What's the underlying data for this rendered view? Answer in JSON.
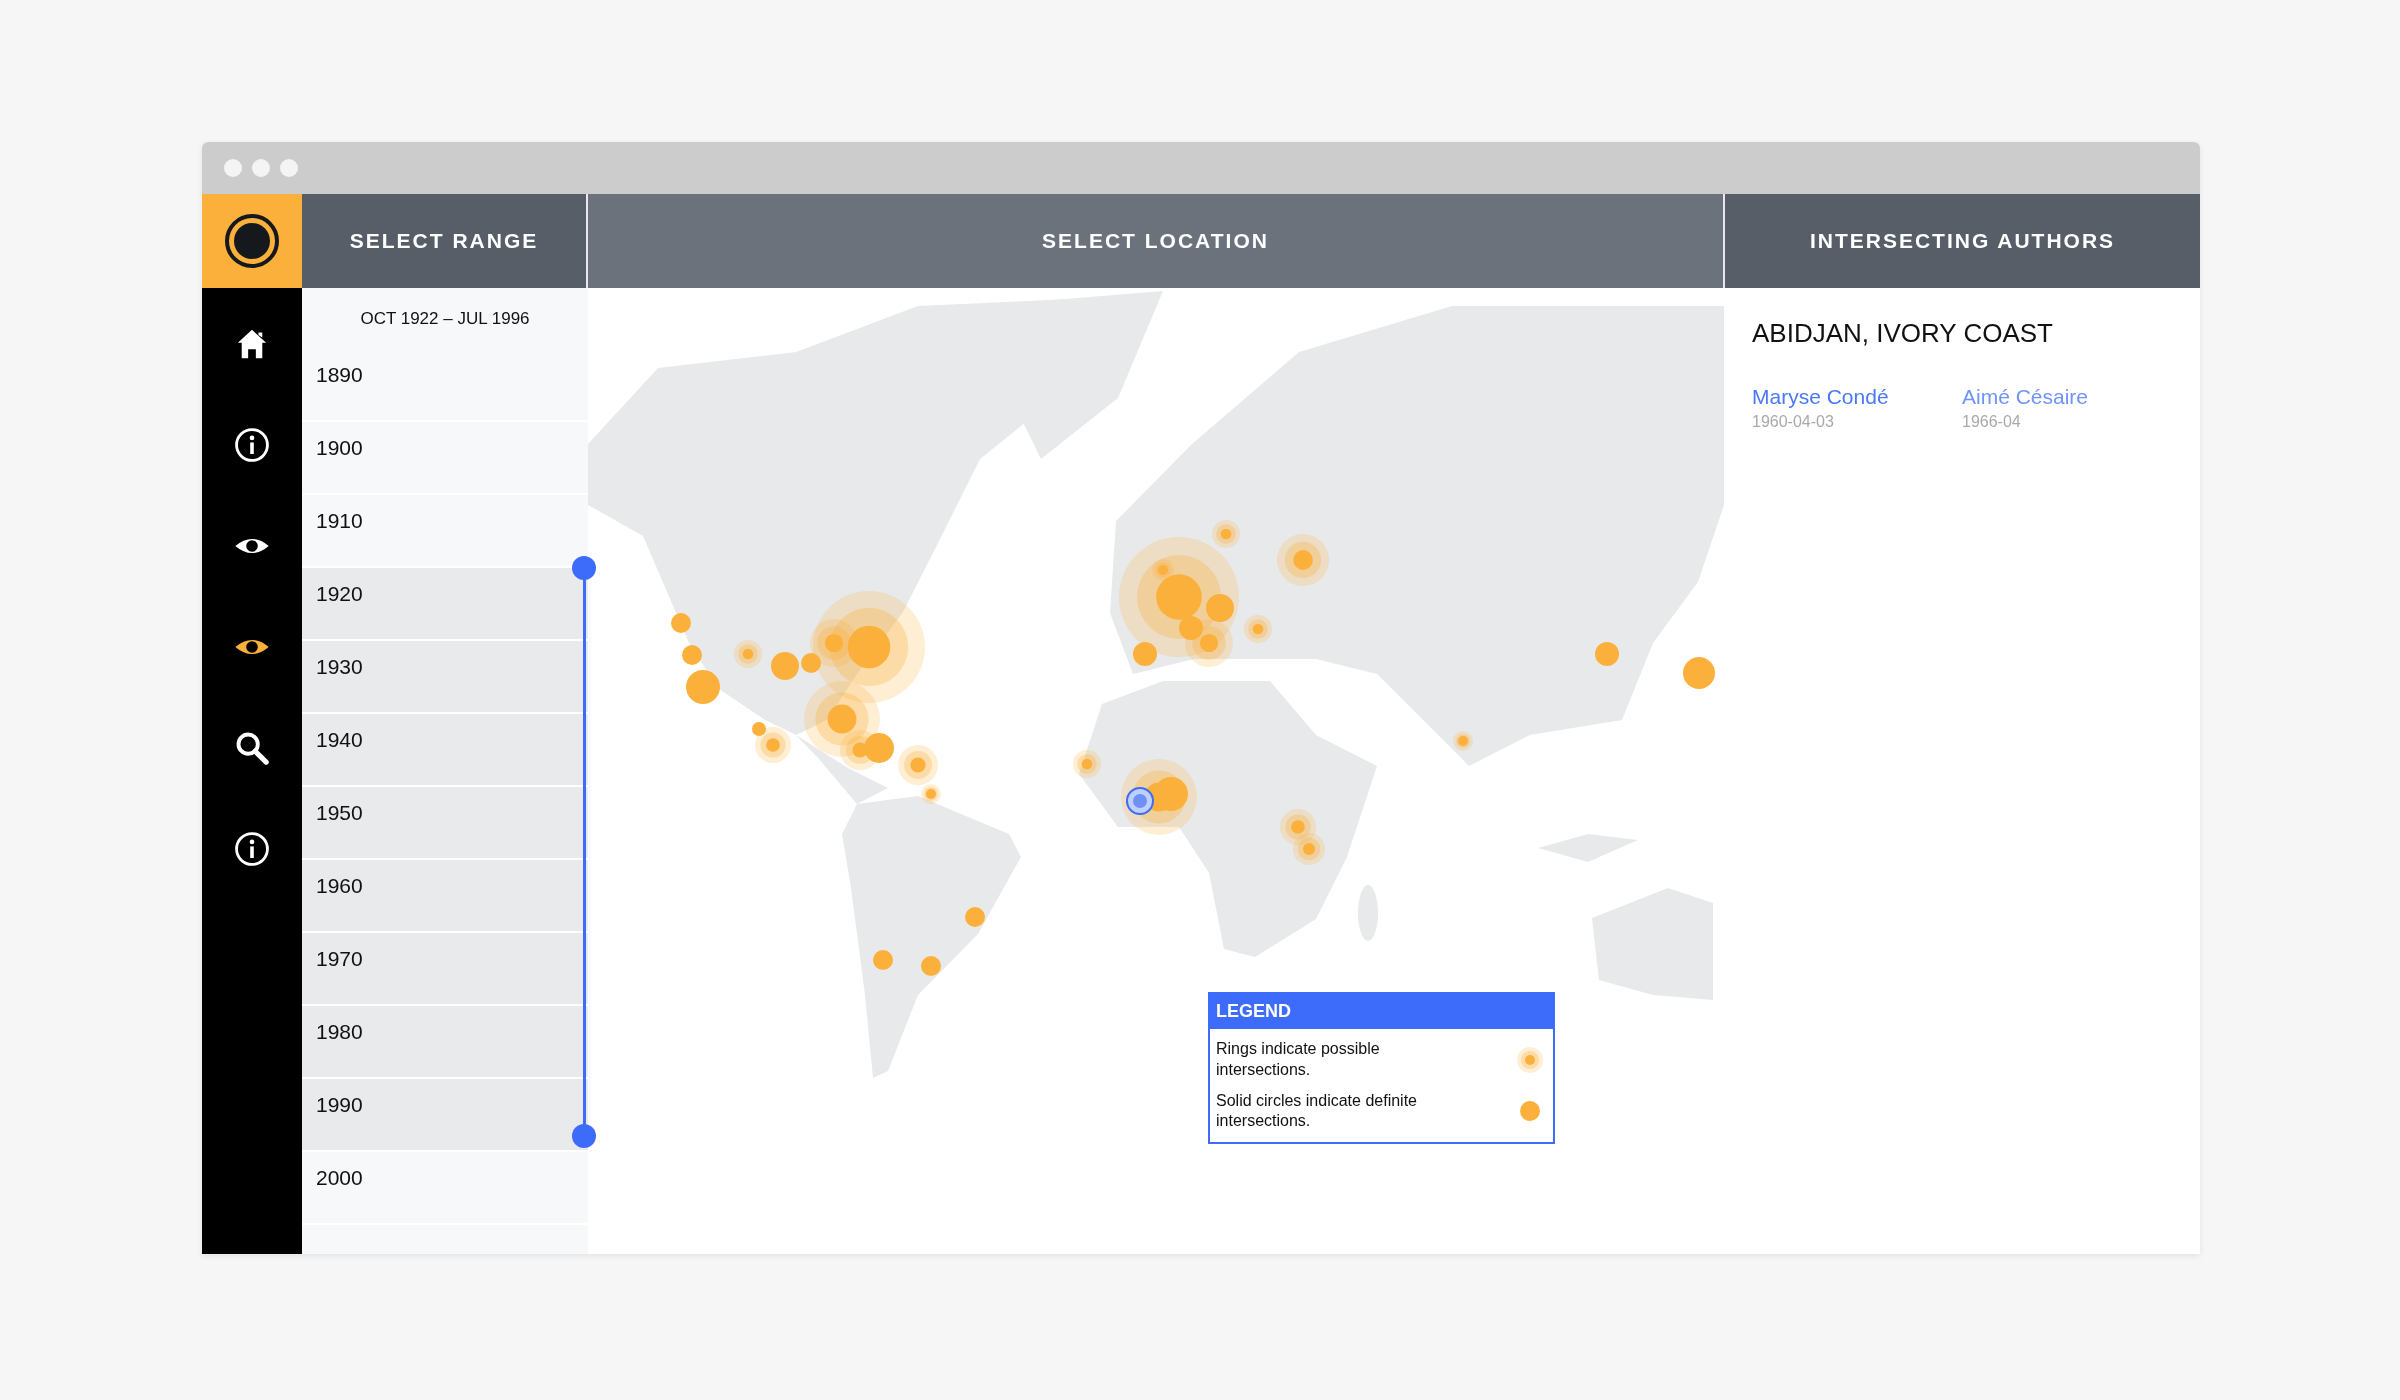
{
  "sidebar": {
    "items": [
      {
        "kind": "home",
        "selected": false
      },
      {
        "kind": "info",
        "selected": false
      },
      {
        "kind": "eye",
        "selected": false
      },
      {
        "kind": "eye",
        "selected": true
      },
      {
        "kind": "search",
        "selected": false
      },
      {
        "kind": "info",
        "selected": false
      }
    ]
  },
  "range": {
    "heading": "SELECT RANGE",
    "summary": "OCT 1922 – JUL 1996",
    "years": [
      {
        "label": "1890",
        "selected": false
      },
      {
        "label": "1900",
        "selected": false
      },
      {
        "label": "1910",
        "selected": false
      },
      {
        "label": "1920",
        "selected": true
      },
      {
        "label": "1930",
        "selected": true
      },
      {
        "label": "1940",
        "selected": true
      },
      {
        "label": "1950",
        "selected": true
      },
      {
        "label": "1960",
        "selected": true
      },
      {
        "label": "1970",
        "selected": true
      },
      {
        "label": "1980",
        "selected": true
      },
      {
        "label": "1990",
        "selected": true
      },
      {
        "label": "2000",
        "selected": false
      }
    ]
  },
  "map": {
    "heading": "SELECT LOCATION",
    "markers": [
      {
        "kind": "solid",
        "selected": false
      },
      {
        "kind": "solid",
        "selected": false
      },
      {
        "kind": "solid",
        "selected": false
      },
      {
        "kind": "ring",
        "selected": false
      },
      {
        "kind": "solid",
        "selected": false
      },
      {
        "kind": "ring",
        "selected": false
      },
      {
        "kind": "ring",
        "selected": false
      },
      {
        "kind": "solid",
        "selected": false
      },
      {
        "kind": "ring",
        "selected": false
      },
      {
        "kind": "solid",
        "selected": false
      },
      {
        "kind": "ring",
        "selected": false
      },
      {
        "kind": "ring",
        "selected": false
      },
      {
        "kind": "solid",
        "selected": false
      },
      {
        "kind": "ring",
        "selected": false
      },
      {
        "kind": "ring",
        "selected": false
      },
      {
        "kind": "solid",
        "selected": false
      },
      {
        "kind": "solid",
        "selected": false
      },
      {
        "kind": "solid",
        "selected": false
      },
      {
        "kind": "ring",
        "selected": false
      },
      {
        "kind": "ring",
        "selected": false
      },
      {
        "kind": "solid",
        "selected": false
      },
      {
        "kind": "ring",
        "selected": true
      },
      {
        "kind": "ring",
        "selected": false
      },
      {
        "kind": "solid",
        "selected": false
      },
      {
        "kind": "solid",
        "selected": false
      },
      {
        "kind": "solid",
        "selected": false
      },
      {
        "kind": "ring",
        "selected": false
      },
      {
        "kind": "ring",
        "selected": false
      },
      {
        "kind": "ring",
        "selected": false
      },
      {
        "kind": "ring",
        "selected": false
      },
      {
        "kind": "ring",
        "selected": false
      },
      {
        "kind": "ring",
        "selected": false
      },
      {
        "kind": "ring",
        "selected": false
      },
      {
        "kind": "solid",
        "selected": false
      },
      {
        "kind": "solid",
        "selected": false
      },
      {
        "kind": "ring",
        "selected": false
      }
    ],
    "legend": {
      "title": "LEGEND",
      "entries": [
        {
          "kind": "ring",
          "text": "Rings indicate possible intersections."
        },
        {
          "kind": "solid",
          "text": "Solid circles indicate definite intersections."
        }
      ]
    }
  },
  "authors": {
    "heading": "INTERSECTING AUTHORS",
    "location": "ABIDJAN, IVORY COAST",
    "people": [
      {
        "name": "Maryse Condé",
        "date": "1960-04-03"
      },
      {
        "name": "Aimé Césaire",
        "date": "1966-04"
      }
    ]
  }
}
